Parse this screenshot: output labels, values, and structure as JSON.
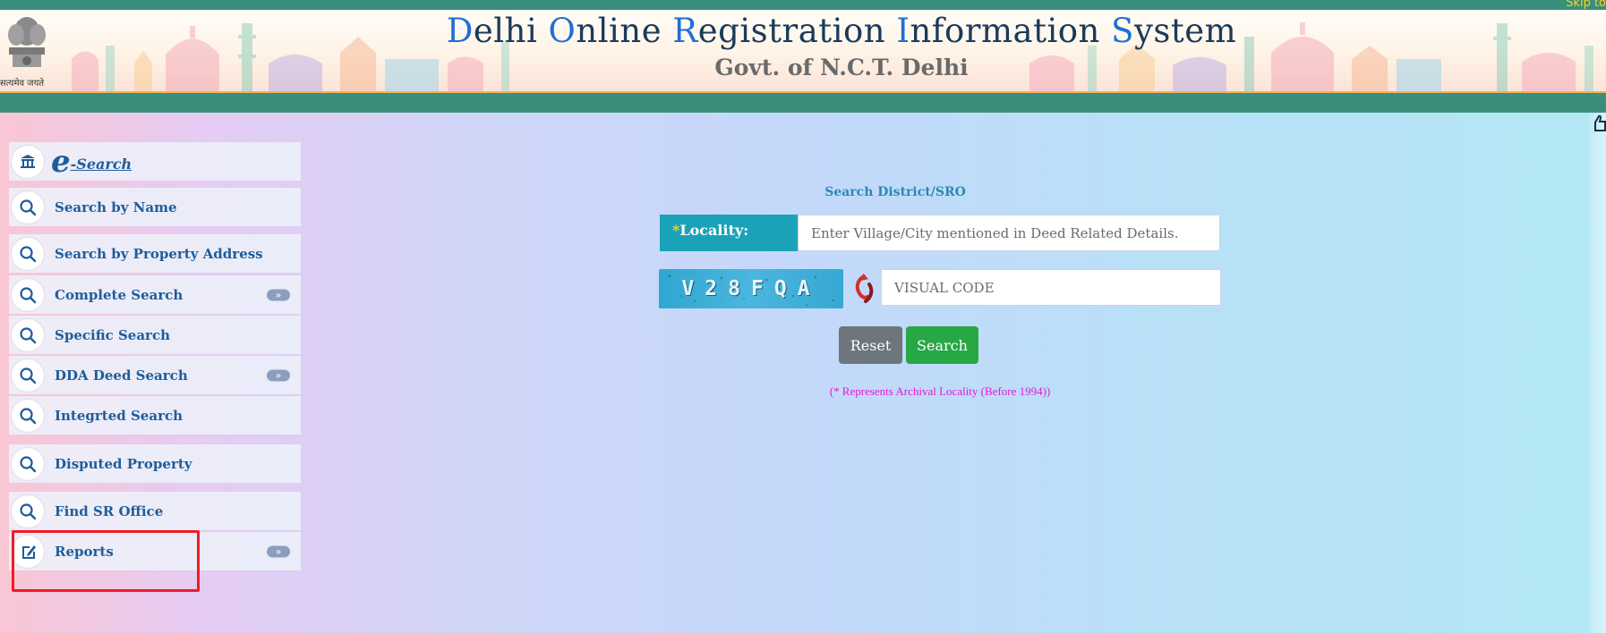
{
  "header": {
    "skip_link": "Skip to",
    "emblem_caption": "सत्यमेव जयते",
    "title_parts": [
      {
        "cap": "D",
        "rest": "elhi "
      },
      {
        "cap": "O",
        "rest": "nline "
      },
      {
        "cap": "R",
        "rest": "egistration "
      },
      {
        "cap": "I",
        "rest": "nformation "
      },
      {
        "cap": "S",
        "rest": "ystem"
      }
    ],
    "subtitle": "Govt. of N.C.T. Delhi"
  },
  "sidebar": {
    "esearch": {
      "e": "e",
      "label": "-Search",
      "icon": "bank-icon"
    },
    "items": [
      {
        "label": "Search by Name",
        "icon": "search-icon",
        "has_arrow": false
      },
      {
        "label": "Search by Property Address",
        "icon": "search-icon",
        "has_arrow": false
      },
      {
        "label": "Complete Search",
        "icon": "search-icon",
        "has_arrow": true
      },
      {
        "label": "Specific Search",
        "icon": "search-icon",
        "has_arrow": false
      },
      {
        "label": "DDA Deed Search",
        "icon": "search-icon",
        "has_arrow": true
      },
      {
        "label": "Integrted Search",
        "icon": "search-icon",
        "has_arrow": false
      },
      {
        "label": "Disputed Property",
        "icon": "search-icon",
        "has_arrow": false
      },
      {
        "label": "Find SR Office",
        "icon": "search-icon",
        "has_arrow": false
      },
      {
        "label": "Reports",
        "icon": "edit-icon",
        "has_arrow": true
      }
    ],
    "arrow_glyph": "»"
  },
  "form": {
    "heading": "Search District/SRO",
    "locality_required_mark": "*",
    "locality_label": "Locality:",
    "locality_placeholder": "Enter Village/City mentioned in Deed Related Details.",
    "locality_value": "",
    "captcha_text": "V28FQA",
    "captcha_placeholder": "VISUAL CODE",
    "captcha_value": "",
    "reset_label": "Reset",
    "search_label": "Search",
    "note": "(* Represents Archival Locality (Before 1994))"
  },
  "colors": {
    "accent_teal": "#3a8f7c",
    "label_bg": "#1aa3b8",
    "link_blue": "#1e5d9b",
    "reset_gray": "#6d757d",
    "search_green": "#28a745",
    "note_magenta": "#e21ad3",
    "highlight_red": "#ee1c25"
  }
}
